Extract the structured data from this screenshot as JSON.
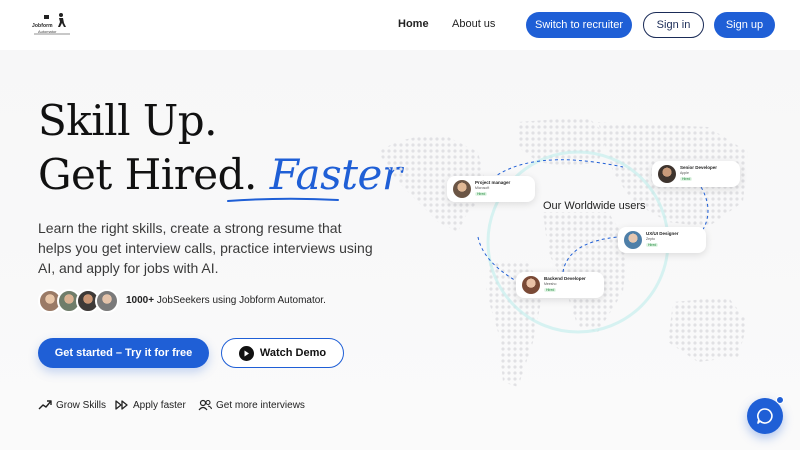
{
  "header": {
    "logo_name": "Jobform",
    "logo_sub": "Automator",
    "nav": {
      "home": "Home",
      "about": "About us"
    },
    "buttons": {
      "recruiter": "Switch to recruiter",
      "signin": "Sign in",
      "signup": "Sign up"
    }
  },
  "hero": {
    "line1": "Skill Up.",
    "line2_prefix": "Get Hired.",
    "line2_highlight": "Faster",
    "subtext": "Learn the right skills, create a strong resume that helps you get interview calls, practice interviews using AI, and apply for jobs with AI.",
    "jobseekers_bold": "1000+",
    "jobseekers_rest": "JobSeekers using Jobform Automator.",
    "cta_primary": "Get started – Try it for free",
    "cta_demo": "Watch Demo",
    "features": [
      {
        "icon": "trending-up-icon",
        "label": "Grow Skills"
      },
      {
        "icon": "fast-forward-icon",
        "label": "Apply faster"
      },
      {
        "icon": "users-icon",
        "label": "Get more interviews"
      }
    ]
  },
  "map": {
    "label": "Our Worldwide users",
    "cards": [
      {
        "title": "Project manager",
        "company": "Microsoft",
        "badge": "Hired"
      },
      {
        "title": "Senior Developer",
        "company": "Apple",
        "badge": "Hired"
      },
      {
        "title": "UX/UI Designer",
        "company": "Zepto",
        "badge": "Hired"
      },
      {
        "title": "Backend Developer",
        "company": "Meesho",
        "badge": "Hired"
      }
    ]
  },
  "colors": {
    "accent": "#1f5fd6",
    "dark": "#1a2b57",
    "badge_green": "#1e8a3a"
  },
  "chat": {
    "icon": "chat-bubble-icon"
  }
}
